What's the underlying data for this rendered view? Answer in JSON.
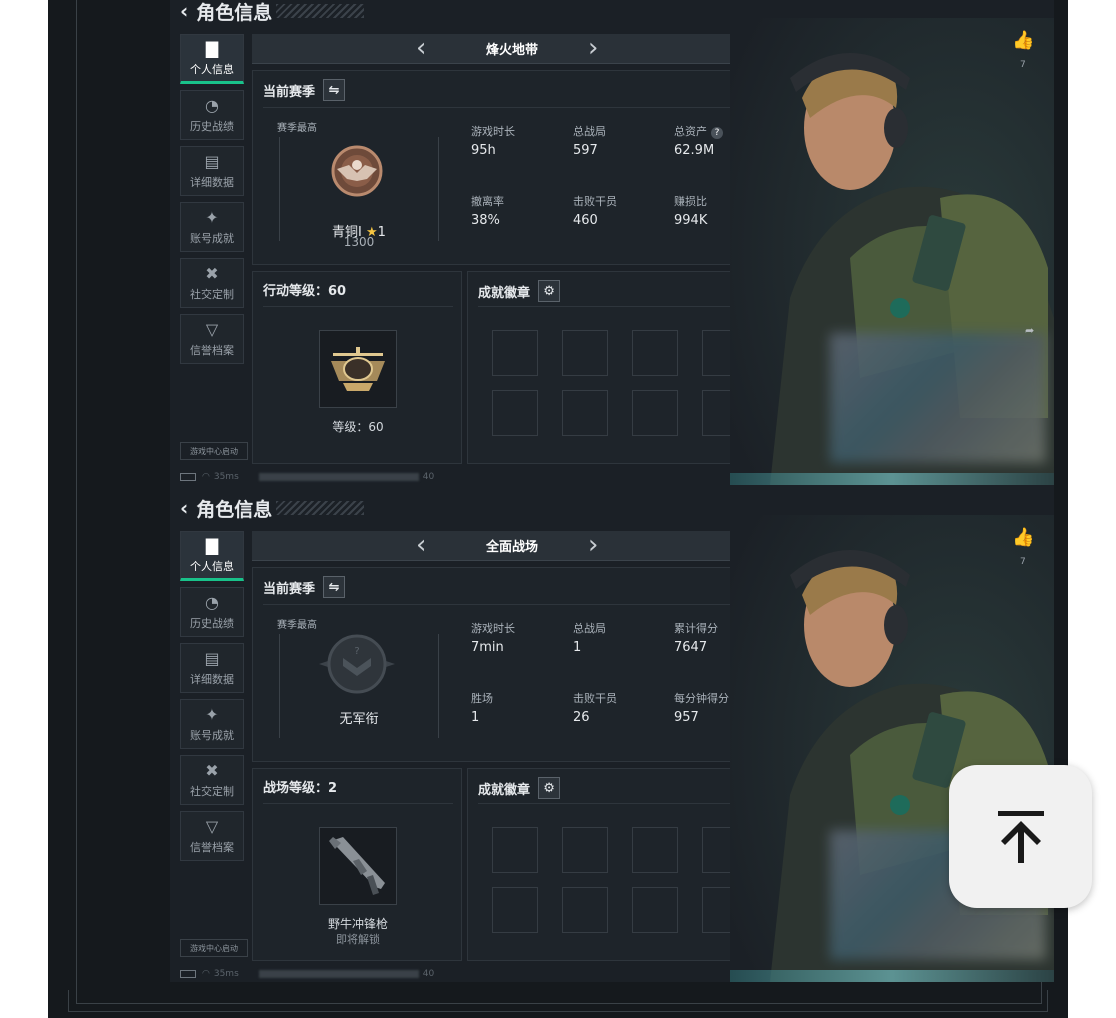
{
  "colors": {
    "accent": "#19c28a",
    "panel_bg": "#1b2026",
    "text": "#e6e9ec"
  },
  "cards": [
    {
      "header": {
        "title": "角色信息",
        "back_icon": "chevron-left-icon"
      },
      "nav": [
        {
          "label": "个人信息",
          "icon": "bar-chart-icon",
          "active": true
        },
        {
          "label": "历史战绩",
          "icon": "clock-icon"
        },
        {
          "label": "详细数据",
          "icon": "folder-icon"
        },
        {
          "label": "账号成就",
          "icon": "achievement-icon"
        },
        {
          "label": "社交定制",
          "icon": "tools-icon"
        },
        {
          "label": "信誉档案",
          "icon": "shield-icon"
        }
      ],
      "game_center": "游戏中心启动",
      "status": {
        "ping": "35ms",
        "count": "40"
      },
      "mode": "烽火地带",
      "season": {
        "title": "当前赛季",
        "best_label": "赛季最高",
        "rank_name": "青铜Ⅰ",
        "rank_stars": "1",
        "rank_score": "1300",
        "stats": [
          {
            "label": "游戏时长",
            "value": "95h"
          },
          {
            "label": "总战局",
            "value": "597"
          },
          {
            "label": "总资产",
            "value": "62.9M",
            "help": "?"
          },
          {
            "label": "撤离率",
            "value": "38%"
          },
          {
            "label": "击败干员",
            "value": "460"
          },
          {
            "label": "赚损比",
            "value": "994K"
          }
        ]
      },
      "level": {
        "title": "行动等级：60",
        "caption": "等级：60"
      },
      "badges": {
        "title": "成就徽章"
      },
      "likes": {
        "count": "7"
      }
    },
    {
      "header": {
        "title": "角色信息",
        "back_icon": "chevron-left-icon"
      },
      "nav": [
        {
          "label": "个人信息",
          "icon": "bar-chart-icon",
          "active": true
        },
        {
          "label": "历史战绩",
          "icon": "clock-icon"
        },
        {
          "label": "详细数据",
          "icon": "folder-icon"
        },
        {
          "label": "账号成就",
          "icon": "achievement-icon"
        },
        {
          "label": "社交定制",
          "icon": "tools-icon"
        },
        {
          "label": "信誉档案",
          "icon": "shield-icon"
        }
      ],
      "game_center": "游戏中心启动",
      "status": {
        "ping": "35ms",
        "count": "40"
      },
      "mode": "全面战场",
      "season": {
        "title": "当前赛季",
        "best_label": "赛季最高",
        "rank_name": "无军衔",
        "stats": [
          {
            "label": "游戏时长",
            "value": "7min"
          },
          {
            "label": "总战局",
            "value": "1"
          },
          {
            "label": "累计得分",
            "value": "7647"
          },
          {
            "label": "胜场",
            "value": "1"
          },
          {
            "label": "击败干员",
            "value": "26"
          },
          {
            "label": "每分钟得分",
            "value": "957"
          }
        ]
      },
      "level": {
        "title": "战场等级：2",
        "caption": "野牛冲锋枪",
        "caption2": "即将解锁"
      },
      "badges": {
        "title": "成就徽章"
      },
      "likes": {
        "count": "7"
      }
    }
  ]
}
